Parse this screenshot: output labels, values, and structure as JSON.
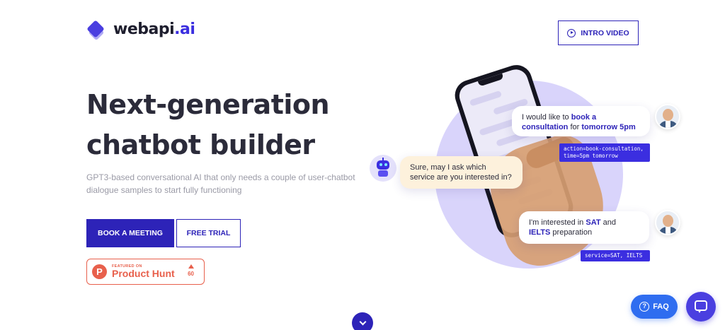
{
  "header": {
    "logo_text": "webapi",
    "logo_suffix": ".ai",
    "intro_video_label": "INTRO VIDEO"
  },
  "hero": {
    "title_line1": "Next-generation",
    "title_line2": "chatbot builder",
    "subtitle": "GPT3-based conversational AI that only needs a couple of user-chatbot dialogue samples to start fully functioning",
    "book_meeting_label": "BOOK A MEETING",
    "free_trial_label": "FREE TRIAL"
  },
  "product_hunt": {
    "letter": "P",
    "featured_label": "FEATURED ON",
    "name": "Product Hunt",
    "votes": "60"
  },
  "chat": {
    "user_msg1_pre": "I would like to ",
    "user_msg1_hl1": "book a consultation",
    "user_msg1_mid": " for ",
    "user_msg1_hl2": "tomorrow 5pm",
    "code1_line1": "action=book-consultation,",
    "code1_line2": "time=5pm tomorrow",
    "bot_msg": "Sure, may I ask which service are you interested in?",
    "user_msg2_pre": "I'm interested in ",
    "user_msg2_hl1": "SAT",
    "user_msg2_mid": " and ",
    "user_msg2_hl2": "IELTS",
    "user_msg2_post": " preparation",
    "code2": "service=SAT, IELTS"
  },
  "floating": {
    "faq_label": "FAQ",
    "help_symbol": "?"
  },
  "colors": {
    "brand": "#2d23b8",
    "accent": "#3b2ee0",
    "product_hunt": "#e8604c",
    "faq": "#2f6df0"
  }
}
